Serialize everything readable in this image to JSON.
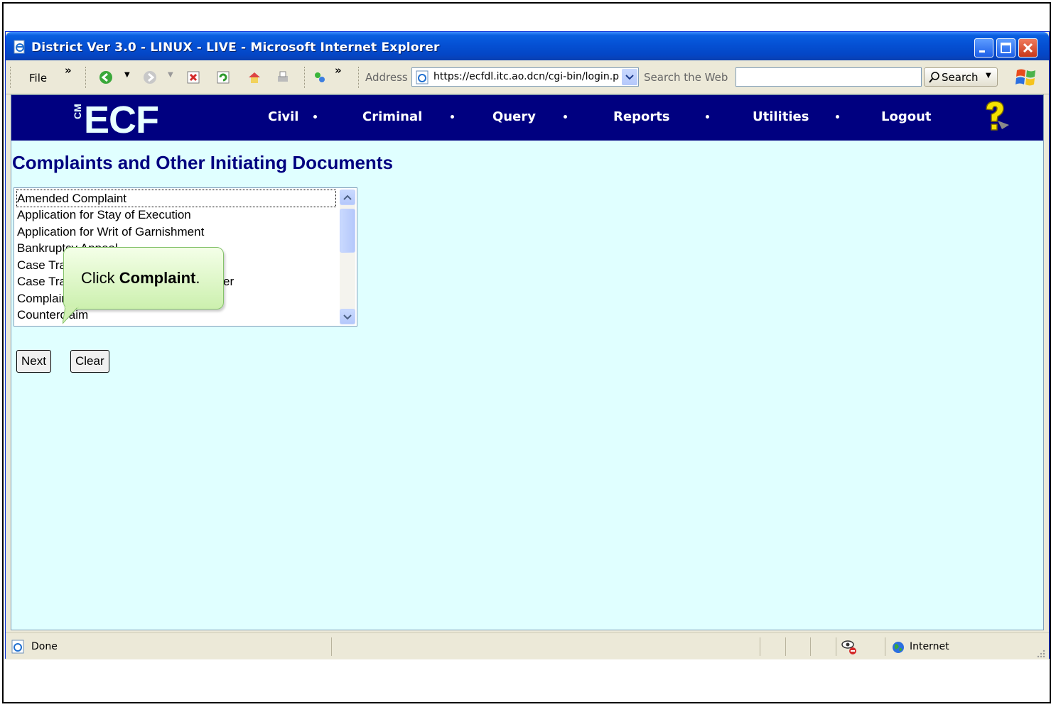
{
  "window": {
    "title": "District Ver 3.0 - LINUX - LIVE - Microsoft Internet Explorer"
  },
  "toolbar": {
    "file_label": "File",
    "chevron": "»",
    "address_label": "Address",
    "address_value": "https://ecfdl.itc.ao.dcn/cgi-bin/login.p",
    "search_the_web_label": "Search the Web",
    "search_value": "",
    "search_button_label": "Search"
  },
  "ecf": {
    "logo_text": "ECF",
    "logo_prefix": "CM",
    "menu": [
      "Civil",
      "Criminal",
      "Query",
      "Reports",
      "Utilities",
      "Logout"
    ]
  },
  "page": {
    "title": "Complaints and Other Initiating Documents"
  },
  "listbox": {
    "items": [
      "Amended Complaint",
      "Application for Stay of Execution",
      "Application for Writ of Garnishment",
      "Bankruptcy Appeal",
      "Case Transferred In - District Transfer",
      "Case Transferred In - Divisional Transfer",
      "Complaint",
      "Counterclaim"
    ],
    "selected_index": 0
  },
  "buttons": {
    "next": "Next",
    "clear": "Clear"
  },
  "callout": {
    "prefix": "Click ",
    "bold": "Complaint",
    "suffix": "."
  },
  "status": {
    "text": "Done",
    "zone": "Internet"
  },
  "colors": {
    "ecf_bar": "#000080",
    "content_bg": "#e0ffff",
    "title_color": "#000080",
    "callout_bg": "#d8f5be"
  }
}
